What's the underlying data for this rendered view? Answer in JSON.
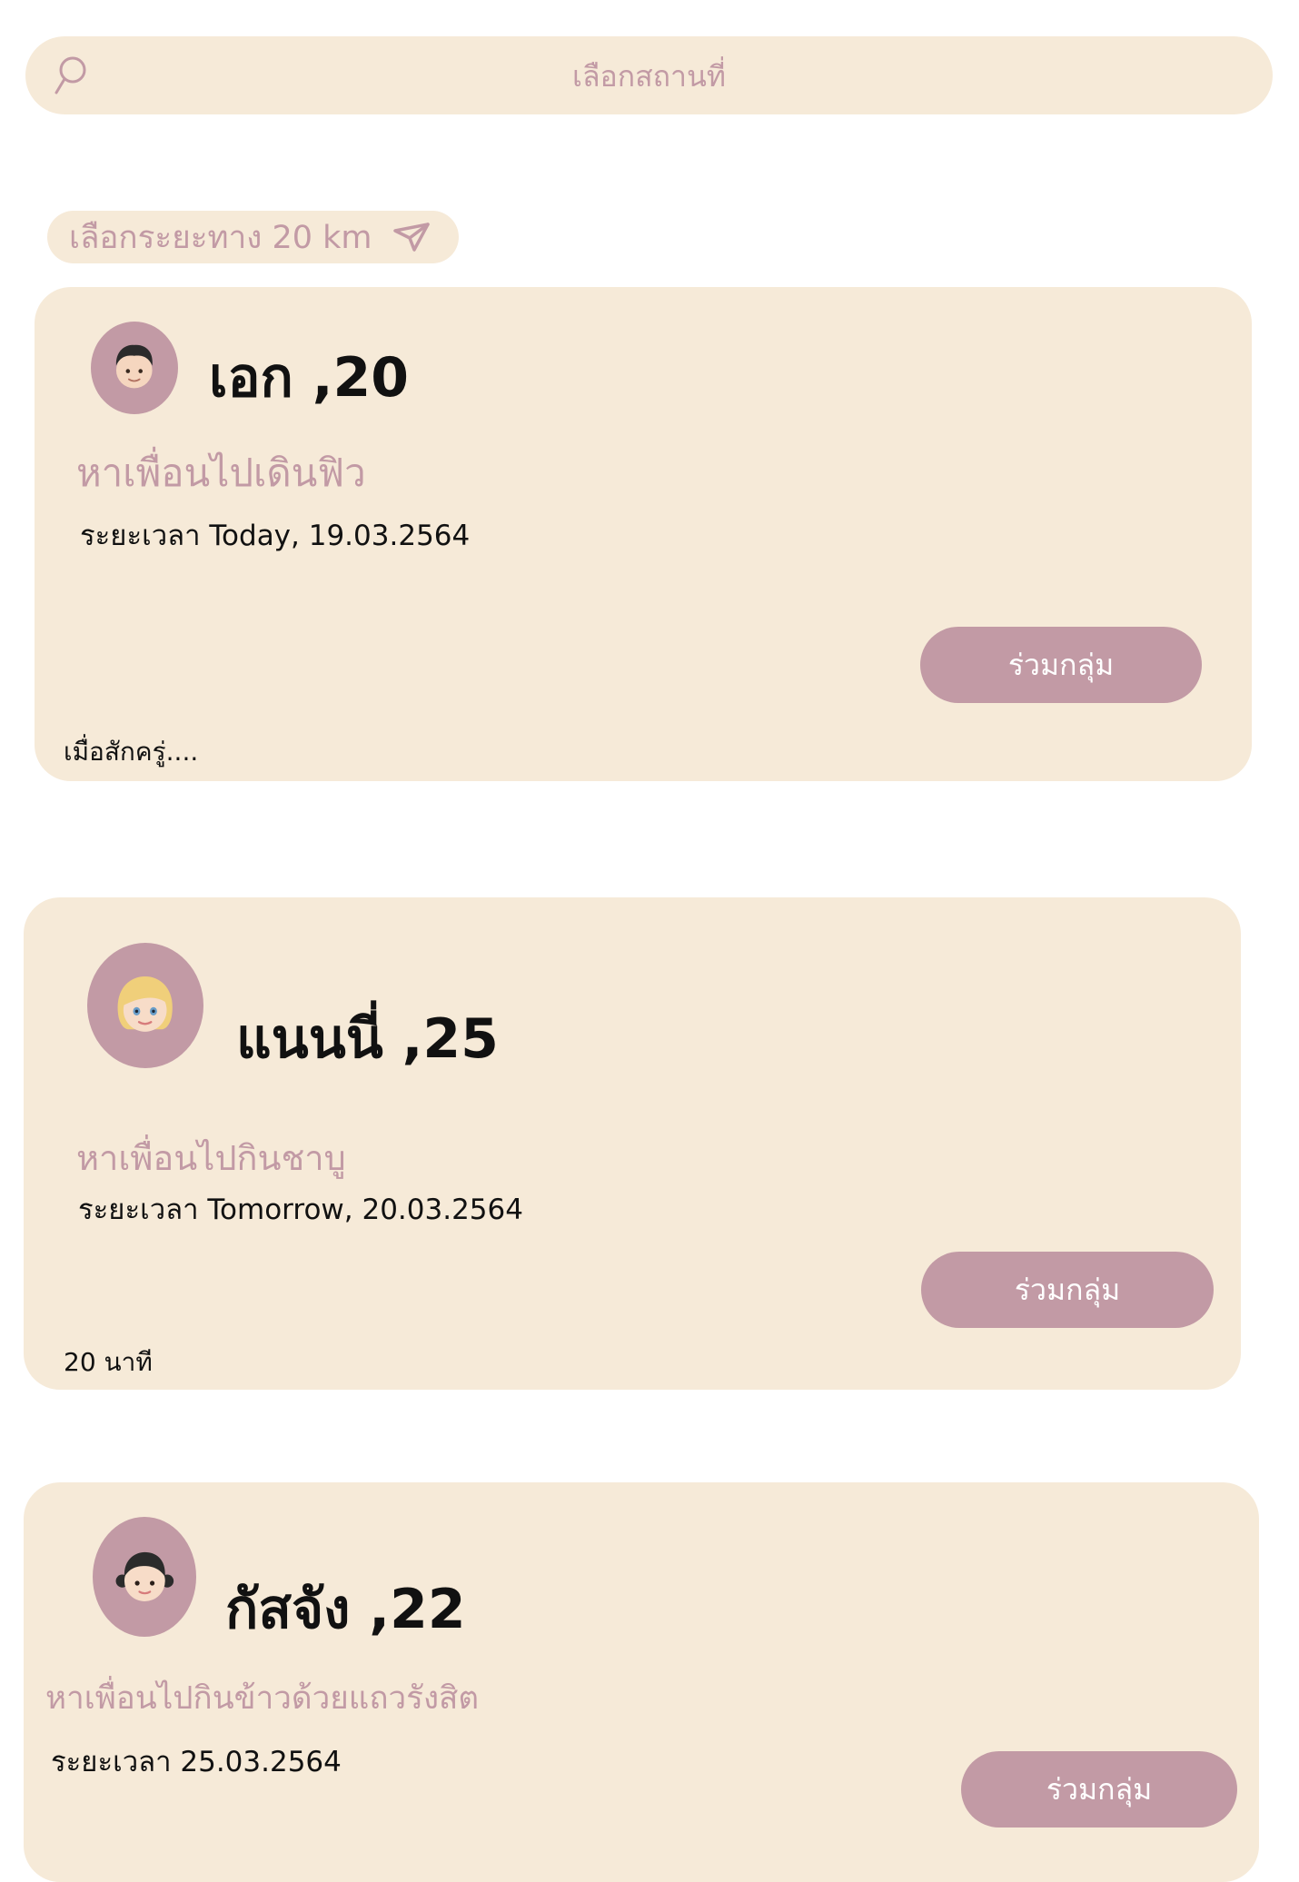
{
  "search": {
    "placeholder": "เลือกสถานที่"
  },
  "distance": {
    "label": "เลือกระยะทาง 20 km"
  },
  "colors": {
    "card_bg": "#f6ead8",
    "accent": "#c29aa5",
    "text": "#111111"
  },
  "posts": [
    {
      "name": "เอก ,20",
      "avatar_icon": "boy-face-icon",
      "activity": "หาเพื่อนไปเดินฟิว",
      "schedule": "ระยะเวลา Today, 19.03.2564",
      "join_label": "ร่วมกลุ่ม",
      "footnote": "เมื่อสักครู่...."
    },
    {
      "name": "แนนนี่ ,25",
      "avatar_icon": "blonde-girl-face-icon",
      "activity": "หาเพื่อนไปกินชาบู",
      "schedule": "ระยะเวลา Tomorrow, 20.03.2564",
      "join_label": "ร่วมกลุ่ม",
      "footnote": "20 นาที"
    },
    {
      "name": "กัสจัง ,22",
      "avatar_icon": "girl-face-icon",
      "activity": "หาเพื่อนไปกินข้าวด้วยแถวรังสิต",
      "schedule": "ระยะเวลา 25.03.2564",
      "join_label": "ร่วมกลุ่ม"
    }
  ]
}
